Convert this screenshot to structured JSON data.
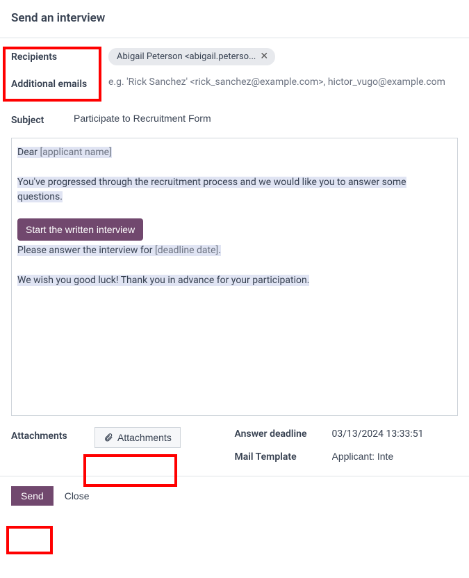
{
  "header": {
    "title": "Send an interview"
  },
  "form": {
    "recipients_label": "Recipients",
    "recipient_chip": "Abigail Peterson <abigail.peterso...",
    "additional_emails_label": "Additional emails",
    "additional_emails_placeholder": "e.g.  'Rick Sanchez' <rick_sanchez@example.com>, hictor_vugo@example.com",
    "subject_label": "Subject",
    "subject_value": "Participate to Recruitment Form"
  },
  "body": {
    "greeting_prefix": "Dear ",
    "greeting_var": "[applicant name]",
    "line2": "You've progressed through the recruitment process and we would like you to answer some questions.",
    "cta_label": "Start the written interview",
    "line4_prefix": "Please answer the interview for ",
    "line4_var": "[deadline date]",
    "line4_suffix": ".",
    "line5": "We wish you good luck! Thank you in advance for your participation."
  },
  "attachments": {
    "label": "Attachments",
    "button_label": "Attachments"
  },
  "meta": {
    "deadline_label": "Answer deadline",
    "deadline_value": "03/13/2024 13:33:51",
    "template_label": "Mail Template",
    "template_value": "Applicant: Inte"
  },
  "footer": {
    "send_label": "Send",
    "close_label": "Close"
  }
}
